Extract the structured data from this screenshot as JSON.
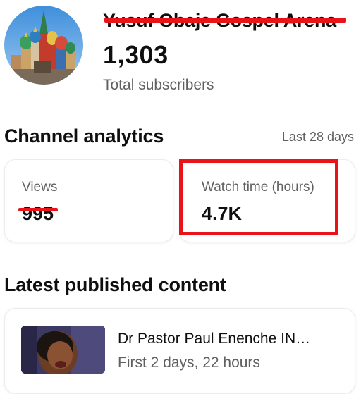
{
  "channel": {
    "name": "Yusuf Obaje Gospel Arena",
    "subscriber_count": "1,303",
    "subscriber_label": "Total subscribers"
  },
  "analytics": {
    "title": "Channel analytics",
    "period": "Last 28 days",
    "views": {
      "label": "Views",
      "value": "995"
    },
    "watch_time": {
      "label": "Watch time (hours)",
      "value": "4.7K"
    }
  },
  "latest": {
    "title": "Latest published content",
    "video": {
      "title": "Dr Pastor Paul Enenche   IN…",
      "meta": "First 2 days, 22 hours"
    }
  },
  "colors": {
    "annotation_red": "#e8141a",
    "secondary_text": "#606060",
    "primary_text": "#0f0f0f"
  }
}
